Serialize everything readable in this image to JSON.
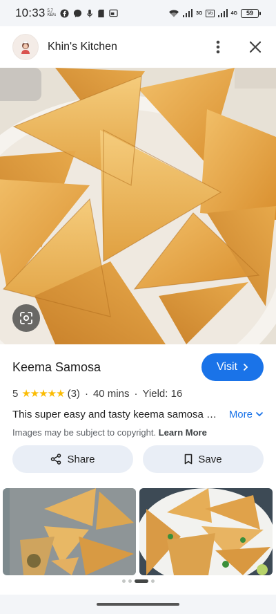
{
  "status": {
    "time": "10:33",
    "net_speed_value": "5.7",
    "net_speed_unit": "KB/s",
    "net_type_1": "3G",
    "volte_label": "Vo",
    "net_type_2": "4G",
    "battery": "59"
  },
  "header": {
    "site_name": "Khin's Kitchen"
  },
  "recipe": {
    "title": "Keema Samosa",
    "visit_label": "Visit",
    "rating": "5",
    "rating_stars": 5,
    "review_count": "(3)",
    "time": "40 mins",
    "yield": "Yield: 16",
    "description": "This super easy and tasty keema samosa recipe is perfect for any occasion",
    "more_label": "More",
    "copyright_text": "Images may be subject to copyright.",
    "learn_more_label": "Learn More"
  },
  "actions": {
    "share_label": "Share",
    "save_label": "Save"
  },
  "pager": {
    "total": 4,
    "active_index": 2
  },
  "colors": {
    "accent": "#1a73e8",
    "star": "#fbbc04",
    "pill_bg": "#e9eef6"
  }
}
